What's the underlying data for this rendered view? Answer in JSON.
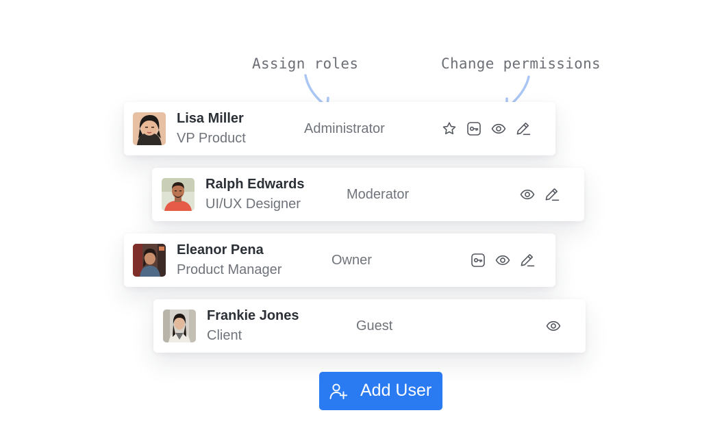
{
  "annotations": {
    "assign_roles": "Assign roles",
    "change_permissions": "Change permissions"
  },
  "colors": {
    "accent": "#2a7bf2",
    "annotation_arrow": "#a9c6f4",
    "text_primary": "#2b2f36",
    "text_secondary": "#6f737a",
    "icon": "#53575e"
  },
  "users": [
    {
      "name": "Lisa Miller",
      "title": "VP Product",
      "role": "Administrator",
      "actions": [
        "star-icon",
        "key-icon",
        "eye-icon",
        "edit-icon"
      ]
    },
    {
      "name": "Ralph Edwards",
      "title": "UI/UX Designer",
      "role": "Moderator",
      "actions": [
        "eye-icon",
        "edit-icon"
      ]
    },
    {
      "name": "Eleanor Pena",
      "title": "Product Manager",
      "role": "Owner",
      "actions": [
        "key-icon",
        "eye-icon",
        "edit-icon"
      ]
    },
    {
      "name": "Frankie Jones",
      "title": "Client",
      "role": "Guest",
      "actions": [
        "eye-icon"
      ]
    }
  ],
  "add_user": {
    "label": "Add User",
    "icon": "user-plus-icon"
  }
}
